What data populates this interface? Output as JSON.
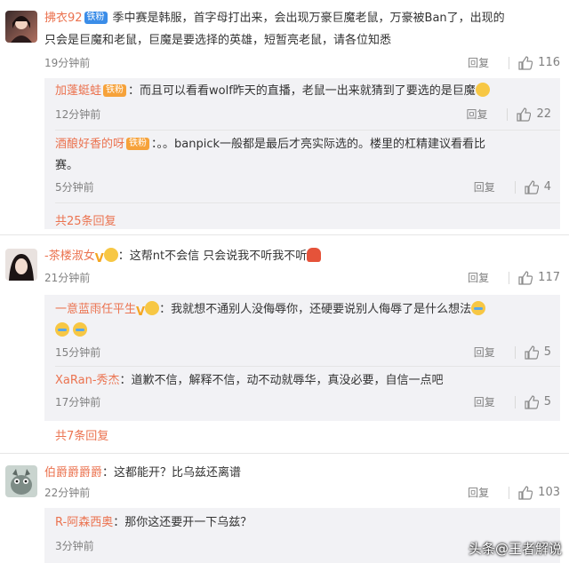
{
  "actions": {
    "reply_label": "回复"
  },
  "comments": [
    {
      "user": "拂衣92",
      "badge": "铁粉",
      "text1": "季中赛是韩服，首字母打出来，会出现万豪巨魔老鼠，万豪被Ban了，出现的",
      "text2": "只会是巨魔和老鼠，巨魔是要选择的英雄，短暂亮老鼠，请各位知悉",
      "time": "19分钟前",
      "likes": "116",
      "replies": [
        {
          "user": "加蓬蜓蛙",
          "badge": "铁粉",
          "text": "：而且可以看看wolf昨天的直播，老鼠一出来就猜到了要选的是巨魔",
          "time": "12分钟前",
          "likes": "22"
        },
        {
          "user": "酒酿好香的呀",
          "badge": "铁粉",
          "text": "：。。banpick一般都是最后才亮实际选的。楼里的杠精建议看看比",
          "text2": "赛。",
          "time": "5分钟前",
          "likes": "4"
        }
      ],
      "more": "共25条回复"
    },
    {
      "user": "-茶楼淑女",
      "text": "：这帮nt不会信 只会说我不听我不听",
      "time": "21分钟前",
      "likes": "117",
      "replies": [
        {
          "user": "一意蓝雨任平生",
          "text": "：我就想不通别人没侮辱你，还硬要说别人侮辱了是什么想法",
          "time": "15分钟前",
          "likes": "5"
        },
        {
          "user": "XaRan-秀杰",
          "text": "：道歉不信，解释不信，动不动就辱华，真没必要，自信一点吧",
          "time": "17分钟前",
          "likes": "5"
        }
      ],
      "more": "共7条回复"
    },
    {
      "user": "伯爵爵爵爵",
      "text": "：这都能开？比乌兹还离谱",
      "time": "22分钟前",
      "likes": "103",
      "replies": [
        {
          "user": "R-阿森西奥",
          "text": "：那你这还要开一下乌兹？",
          "time": "3分钟前"
        }
      ]
    }
  ],
  "watermark": "头条@王者解说",
  "colors": {
    "username": "#eb7350",
    "reply_bg": "#f2f2f5",
    "muted": "#808080"
  }
}
